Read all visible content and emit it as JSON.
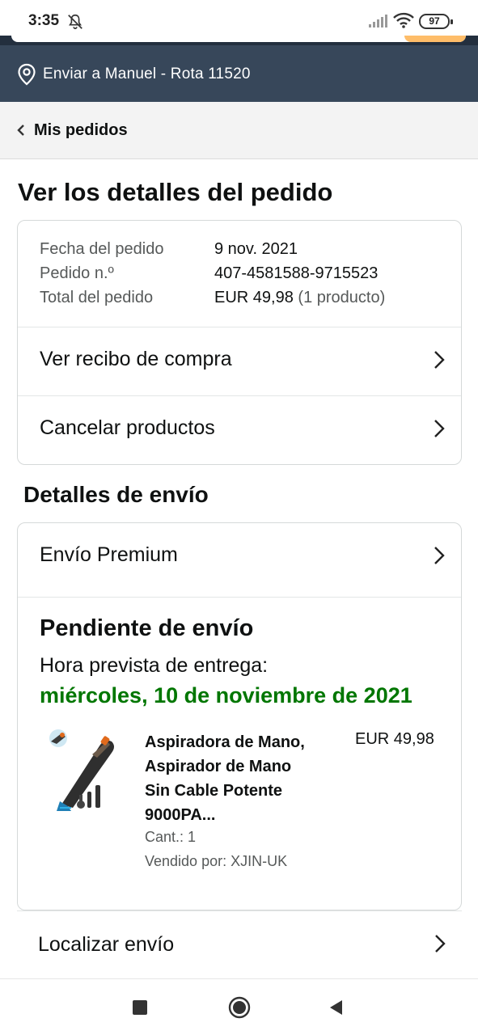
{
  "status_bar": {
    "time": "3:35",
    "battery": "97"
  },
  "deliver_bar": {
    "text": "Enviar a Manuel - Rota 11520"
  },
  "breadcrumb": {
    "label": "Mis pedidos"
  },
  "page_title": "Ver los detalles del pedido",
  "order_summary": {
    "rows": [
      {
        "label": "Fecha del pedido",
        "value": "9 nov. 2021"
      },
      {
        "label": "Pedido n.º",
        "value": "407-4581588-9715523"
      },
      {
        "label": "Total del pedido",
        "value": "EUR 49,98",
        "extra": "(1 producto)"
      }
    ],
    "links": [
      "Ver recibo de compra",
      "Cancelar productos"
    ]
  },
  "shipping": {
    "section_title": "Detalles de envío",
    "method": "Envío Premium",
    "status": "Pendiente de envío",
    "eta_label": "Hora prevista de entrega:",
    "eta_date": "miércoles, 10 de noviembre de 2021",
    "product": {
      "title_lines": [
        "Aspiradora de Mano,",
        "Aspirador de Mano",
        "Sin Cable Potente",
        "9000PA..."
      ],
      "price": "EUR 49,98",
      "quantity": "Cant.: 1",
      "seller": "Vendido por: XJIN-UK"
    },
    "track_label": "Localizar envío"
  },
  "colors": {
    "deliver_bar_bg": "#37475a",
    "eta_green": "#007600",
    "accent_orange": "#febd69"
  },
  "icons": [
    "bell-off-icon",
    "signal-icon",
    "wifi-icon",
    "battery-icon",
    "location-pin-icon",
    "chevron-left-icon",
    "chevron-right-icon",
    "nav-recents-icon",
    "nav-home-icon",
    "nav-back-icon"
  ]
}
